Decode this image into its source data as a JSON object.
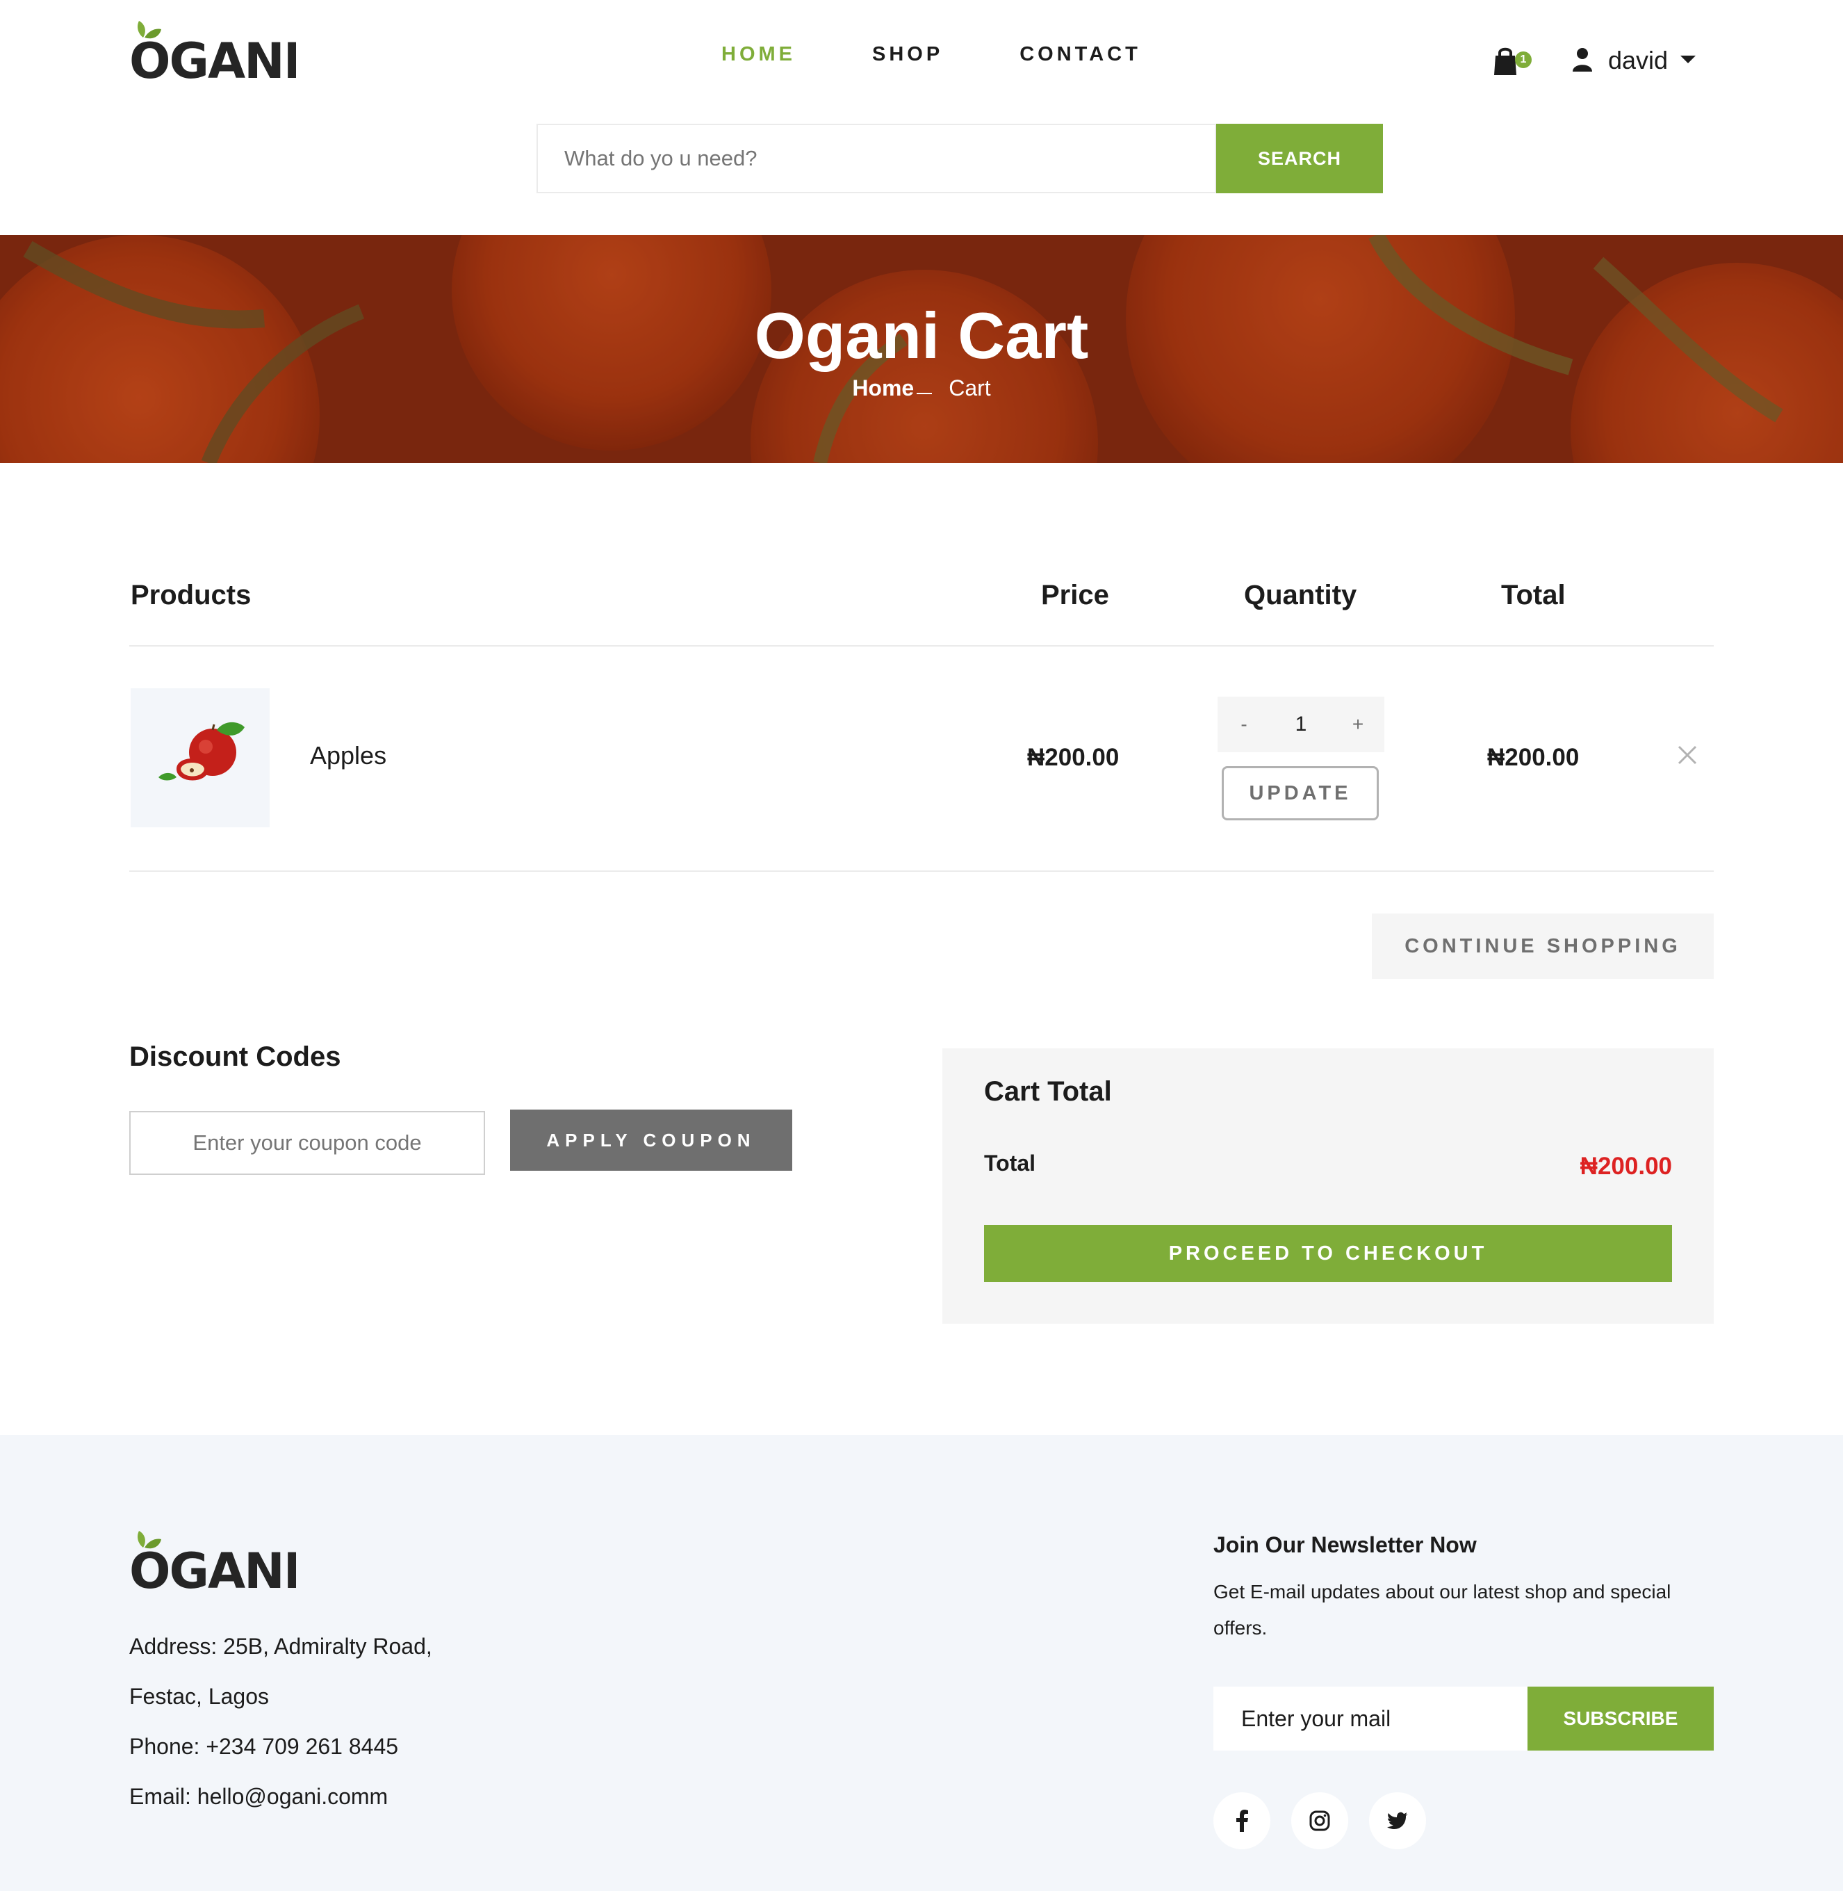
{
  "brand": {
    "logo_text": "OGANI",
    "accent_color": "#7fad39",
    "price_accent_color": "#dd2222"
  },
  "nav": {
    "items": [
      {
        "label": "HOME",
        "active": true
      },
      {
        "label": "SHOP",
        "active": false
      },
      {
        "label": "CONTACT",
        "active": false
      }
    ],
    "cart_count": "1",
    "user_name": "david",
    "icons": {
      "cart": "shopping-bag-icon",
      "user": "user-icon",
      "caret": "caret-down-icon"
    }
  },
  "search": {
    "placeholder": "What do yo u need?",
    "button_label": "SEARCH"
  },
  "banner": {
    "title": "Ogani Cart",
    "breadcrumb_home": "Home",
    "breadcrumb_current": "Cart"
  },
  "cart_table": {
    "headers": {
      "products": "Products",
      "price": "Price",
      "quantity": "Quantity",
      "total": "Total"
    },
    "items": [
      {
        "name": "Apples",
        "price": "₦200.00",
        "quantity": "1",
        "total": "₦200.00",
        "image": "apples-image"
      }
    ],
    "qty_minus": "-",
    "qty_plus": "+",
    "update_label": "UPDATE",
    "continue_label": "CONTINUE SHOPPING"
  },
  "discount": {
    "title": "Discount Codes",
    "placeholder": "Enter your coupon code",
    "button_label": "APPLY COUPON"
  },
  "cart_total": {
    "title": "Cart Total",
    "total_label": "Total",
    "total_value": "₦200.00",
    "checkout_label": "PROCEED TO CHECKOUT"
  },
  "footer": {
    "address_line1": "Address: 25B, Admiralty Road,",
    "address_line2": "Festac, Lagos",
    "phone": "Phone: +234 709 261 8445",
    "email": "Email: hello@ogani.comm",
    "newsletter_title": "Join Our Newsletter Now",
    "newsletter_text": "Get E-mail updates about our latest shop and special offers.",
    "newsletter_placeholder": "Enter your mail",
    "subscribe_label": "SUBSCRIBE",
    "social_icons": [
      "facebook-icon",
      "instagram-icon",
      "twitter-icon"
    ]
  }
}
